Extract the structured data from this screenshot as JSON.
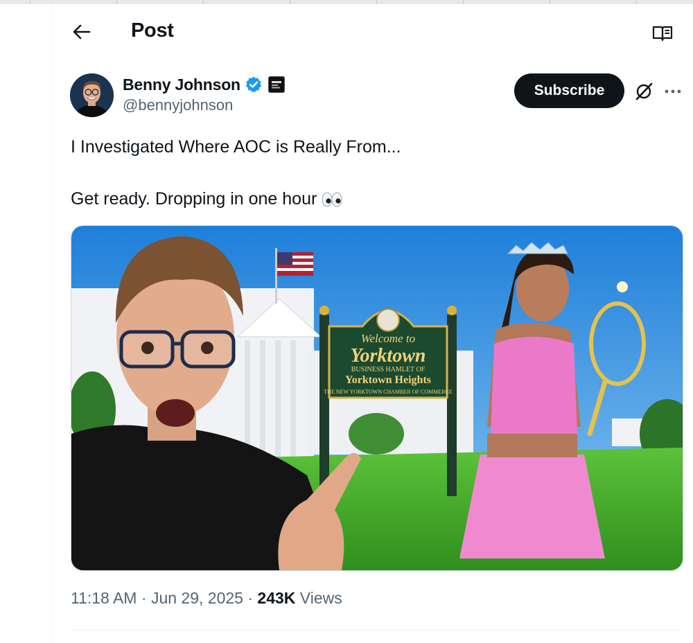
{
  "header": {
    "title": "Post",
    "back_icon": "arrow-left-icon",
    "reader_icon": "book-open-icon"
  },
  "author": {
    "display_name": "Benny Johnson",
    "handle": "@bennyjohnson",
    "verified_color": "#1d9bf0",
    "verified_icon": "verified-badge-icon",
    "affiliate_icon": "affiliate-badge-icon"
  },
  "actions": {
    "subscribe_label": "Subscribe",
    "grok_icon": "grok-icon",
    "more_icon": "more-dots-icon"
  },
  "post": {
    "line1": "I Investigated Where AOC is Really From...",
    "line2": "Get ready. Dropping in one hour",
    "line2_emoji": "eyes-emoji"
  },
  "media": {
    "sign_line1": "Welcome to",
    "sign_line2": "Yorktown",
    "sign_line3": "BUSINESS HAMLET OF",
    "sign_line4": "Yorktown Heights",
    "sign_line5": "THE NEW YORKTOWN CHAMBER OF COMMERCE"
  },
  "meta": {
    "time": "11:18 AM",
    "sep1": " · ",
    "date": "Jun 29, 2025",
    "sep2": " · ",
    "views_count": "243K",
    "views_label": " Views"
  },
  "colors": {
    "text": "#0f1419",
    "secondary": "#536471",
    "border": "#eff3f4",
    "button": "#0f1419"
  }
}
